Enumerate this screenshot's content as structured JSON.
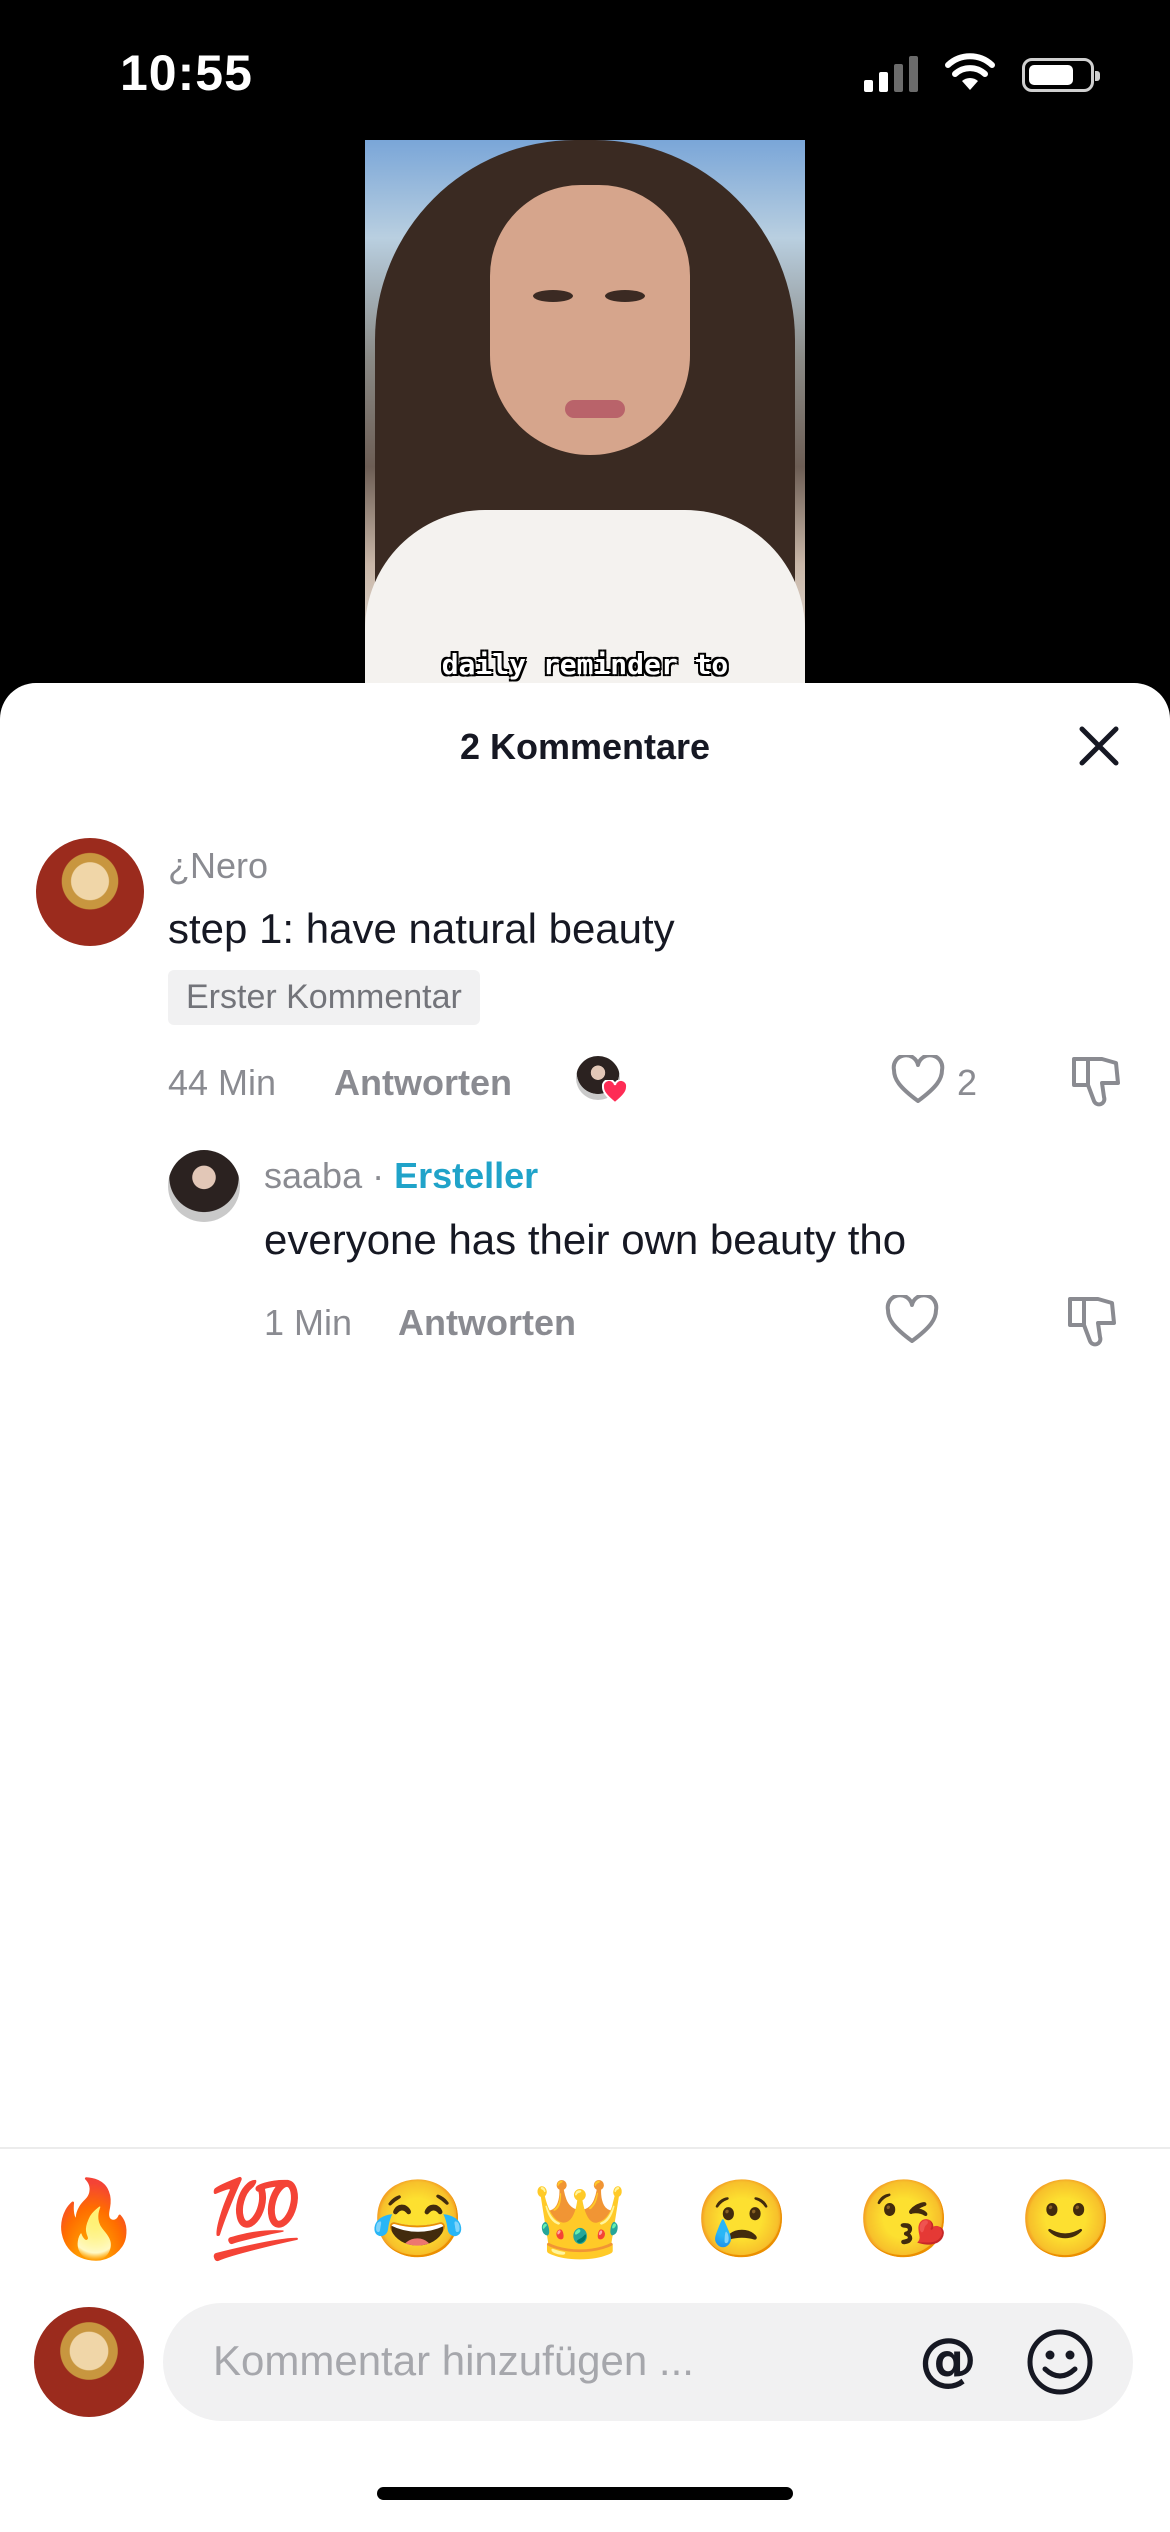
{
  "status": {
    "time": "10:55"
  },
  "video": {
    "caption": "daily reminder to"
  },
  "sheet": {
    "title": "2 Kommentare"
  },
  "comments": [
    {
      "user": "¿Nero",
      "text": "step 1: have natural beauty",
      "badge": "Erster Kommentar",
      "time": "44 Min",
      "reply_label": "Antworten",
      "like_count": "2"
    }
  ],
  "replies": [
    {
      "user": "saaba",
      "separator": " · ",
      "creator_label": "Ersteller",
      "text": "everyone has their own beauty tho",
      "time": "1 Min",
      "reply_label": "Antworten"
    }
  ],
  "emojis": [
    "🔥",
    "💯",
    "😂",
    "👑",
    "😢",
    "😘",
    "🙂"
  ],
  "input": {
    "placeholder": "Kommentar hinzufügen ..."
  },
  "colors": {
    "creator": "#20a3c9",
    "like_heart": "#fe2c55"
  }
}
